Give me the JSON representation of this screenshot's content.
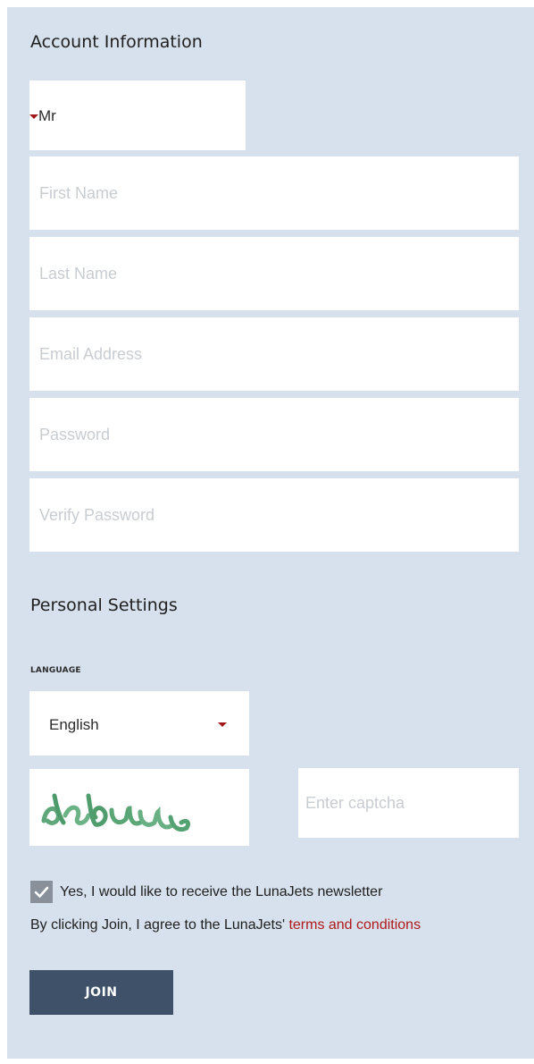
{
  "account": {
    "heading": "Account Information",
    "title_select": {
      "value": "Mr"
    },
    "fields": {
      "first_name": "First Name",
      "last_name": "Last Name",
      "email": "Email Address",
      "password": "Password",
      "verify_password": "Verify Password"
    }
  },
  "personal": {
    "heading": "Personal Settings",
    "language_label": "LANGUAGE",
    "language_select": {
      "value": "English"
    }
  },
  "captcha": {
    "image_text": "debuu",
    "placeholder": "Enter captcha"
  },
  "newsletter": {
    "checked": true,
    "label": "Yes, I would like to receive the LunaJets newsletter"
  },
  "terms": {
    "prefix": "By clicking Join, I agree to the LunaJets' ",
    "link": "terms and conditions"
  },
  "join_button": {
    "label": "JOIN"
  },
  "colors": {
    "panel_background": "#d6e1ed",
    "accent": "#b01a1a",
    "button": "#3e5169",
    "checkbox": "#8a9099"
  },
  "icons": {
    "select_caret": "caret-down-icon",
    "checkbox_mark": "checkmark-icon"
  }
}
